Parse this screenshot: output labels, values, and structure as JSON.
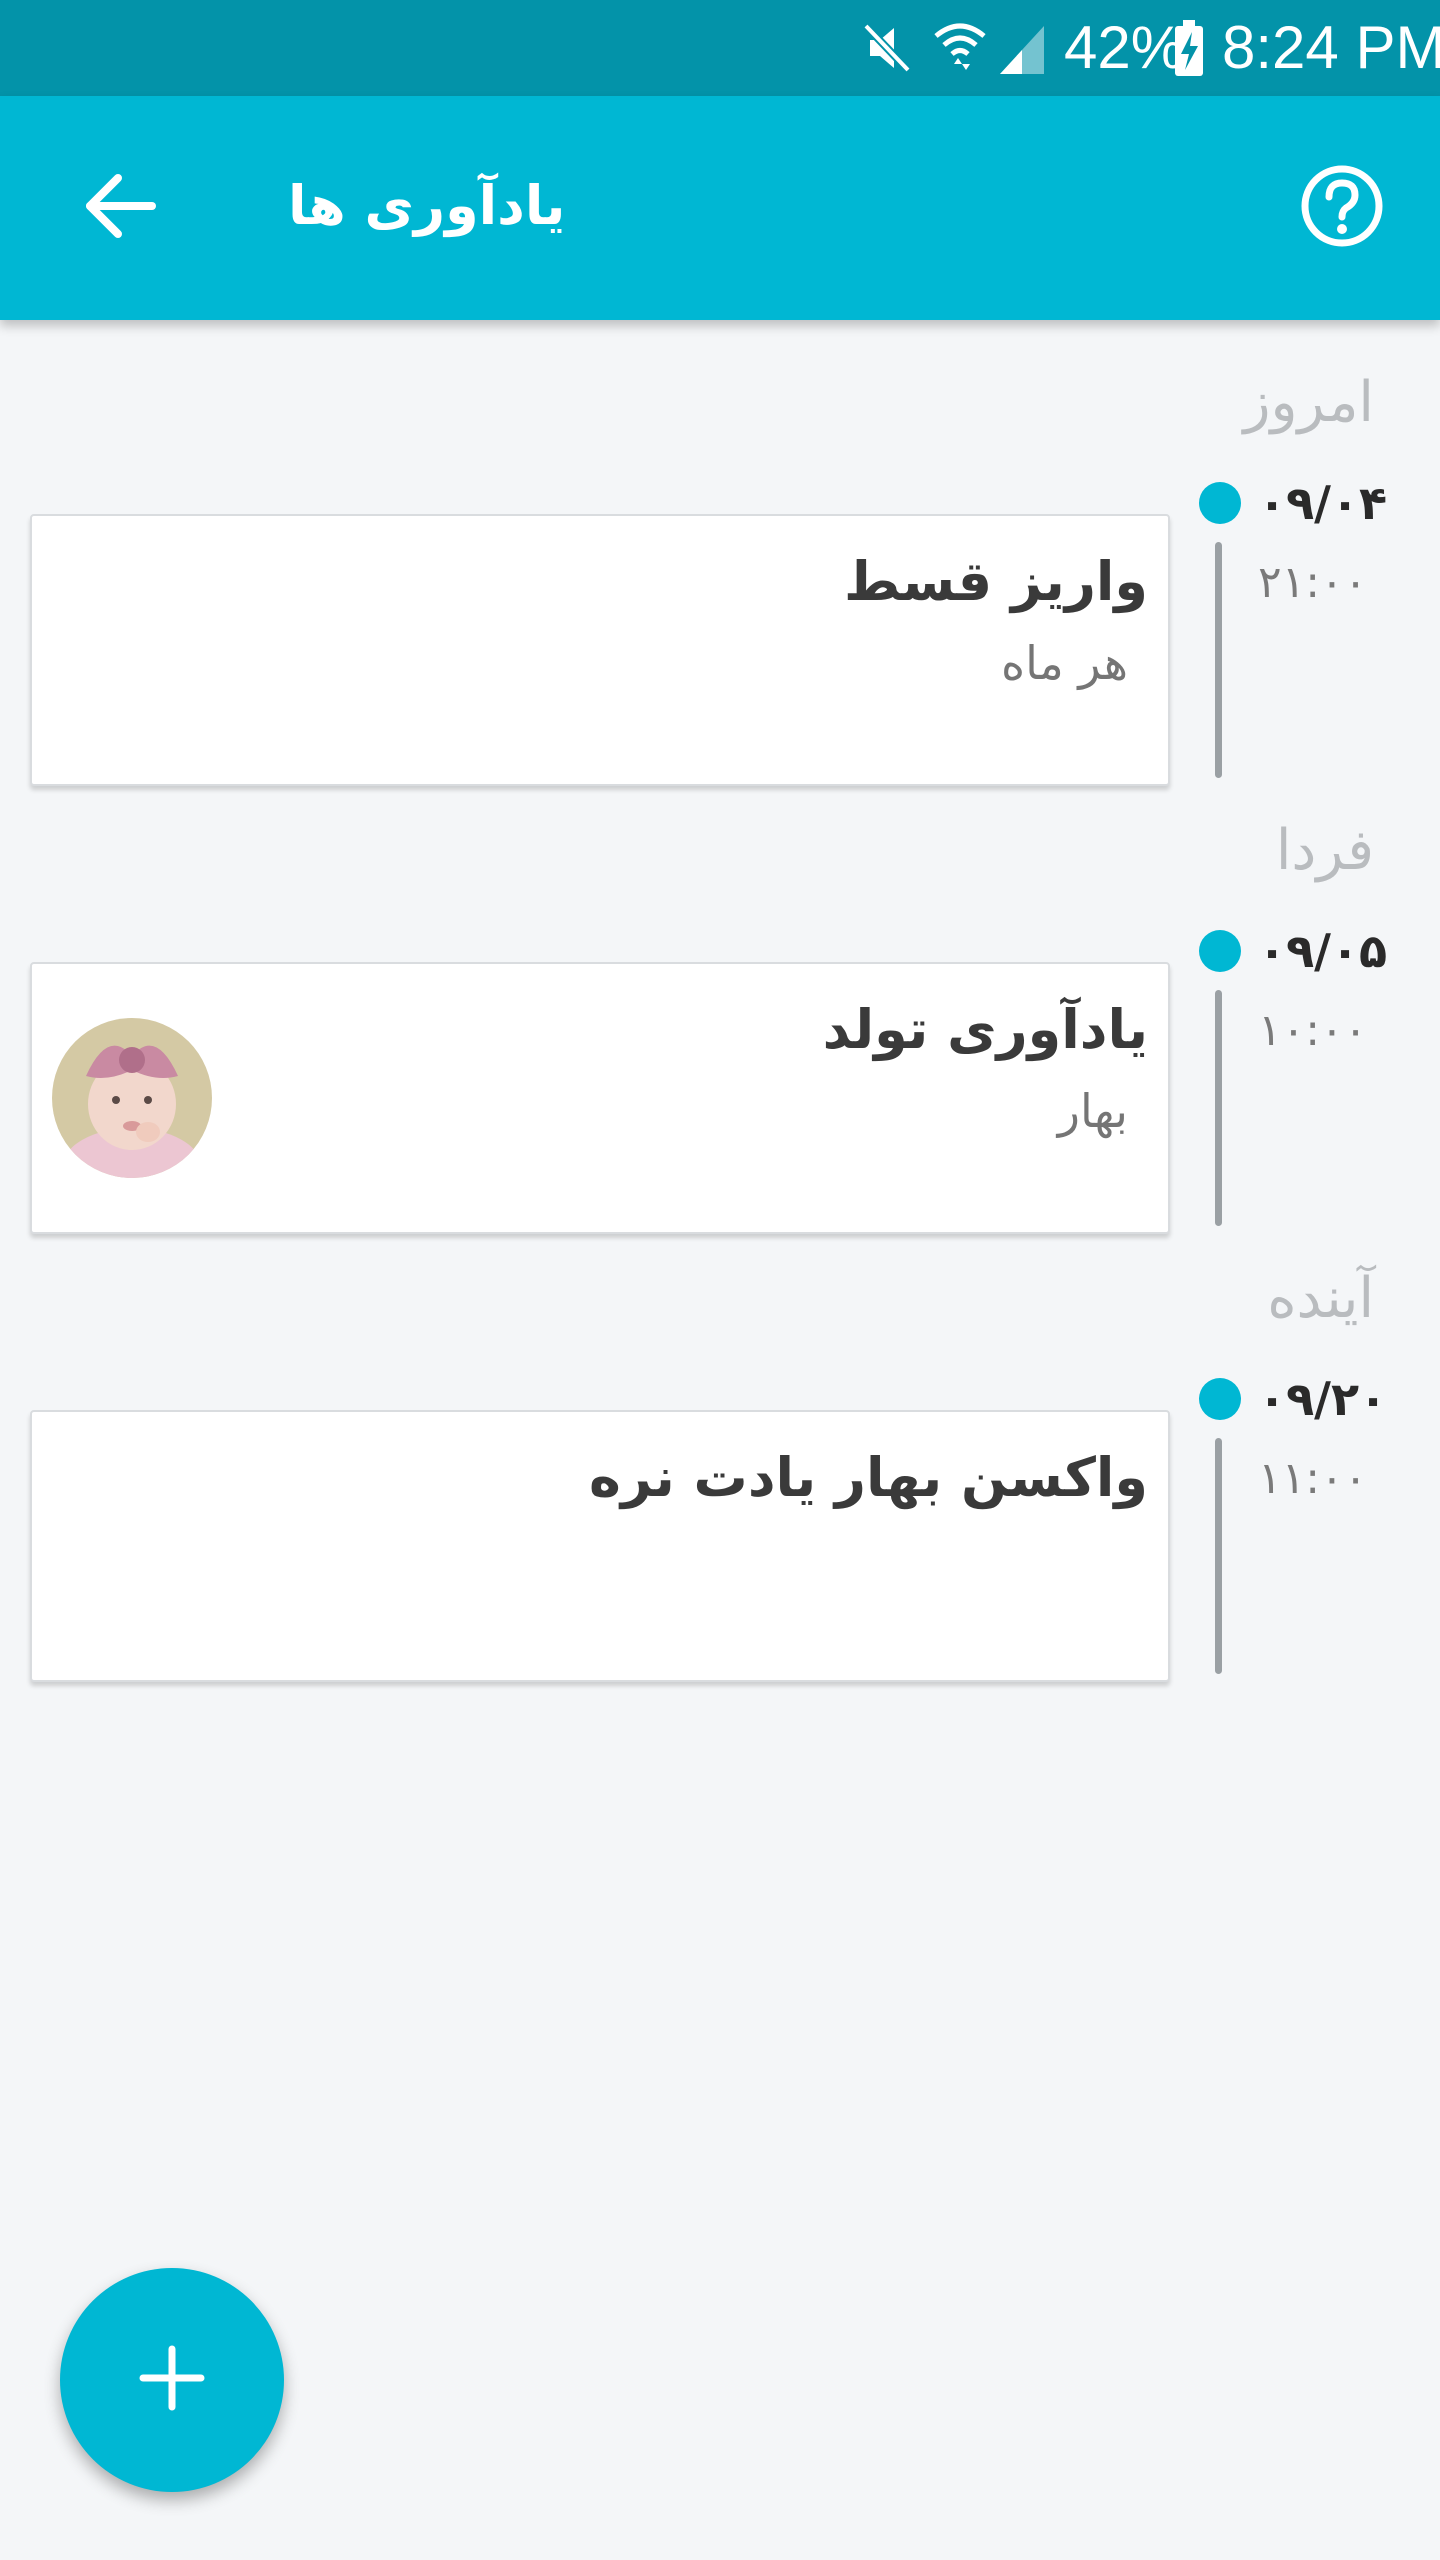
{
  "status_bar": {
    "battery_percent": "42%",
    "time": "8:24 PM",
    "icons": [
      "mute-icon",
      "wifi-icon",
      "signal-icon",
      "battery-charging-icon"
    ]
  },
  "header": {
    "title": "یادآوری ها",
    "back_icon": "arrow-back-icon",
    "help_icon": "help-circle-icon"
  },
  "colors": {
    "accent": "#00b7d3",
    "status_bar": "#0393a9",
    "background": "#f4f6f8"
  },
  "sections": [
    {
      "label": "امروز",
      "date": "۰۹/۰۴",
      "time": "۲۱:۰۰",
      "card": {
        "title": "واریز قسط",
        "subtitle": "هر ماه",
        "has_avatar": false
      }
    },
    {
      "label": "فردا",
      "date": "۰۹/۰۵",
      "time": "۱۰:۰۰",
      "card": {
        "title": "یادآوری تولد",
        "subtitle": "بهار",
        "has_avatar": true
      }
    },
    {
      "label": "آینده",
      "date": "۰۹/۲۰",
      "time": "۱۱:۰۰",
      "card": {
        "title": "واکسن بهار یادت نره",
        "subtitle": "",
        "has_avatar": false
      }
    }
  ],
  "fab": {
    "label": "+",
    "icon": "plus-icon"
  }
}
